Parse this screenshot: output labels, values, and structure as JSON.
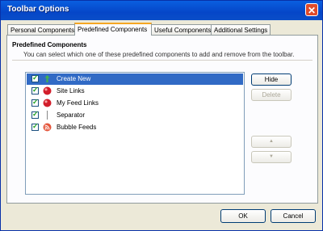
{
  "window": {
    "title": "Toolbar Options",
    "close_glyph": "✕"
  },
  "tabs": [
    {
      "label": "Personal Components"
    },
    {
      "label": "Predefined Components"
    },
    {
      "label": "Useful Components"
    },
    {
      "label": "Additional Settings"
    }
  ],
  "active_tab": "Predefined Components",
  "section": {
    "title": "Predefined Components",
    "description": "You can select which one of these predefined components to add and remove from the toolbar."
  },
  "components": [
    {
      "label": "Create New",
      "checked": true,
      "icon": "green-arrow-icon",
      "selected": true
    },
    {
      "label": "Site Links",
      "checked": true,
      "icon": "red-ball-icon",
      "selected": false
    },
    {
      "label": "My Feed Links",
      "checked": true,
      "icon": "red-ball-icon",
      "selected": false
    },
    {
      "label": "Separator",
      "checked": true,
      "icon": "separator-icon",
      "selected": false
    },
    {
      "label": "Bubble Feeds",
      "checked": true,
      "icon": "rss-bubble-icon",
      "selected": false
    }
  ],
  "side_buttons": {
    "hide": "Hide",
    "delete": "Delete",
    "up": "▲",
    "down": "▼"
  },
  "footer": {
    "ok": "OK",
    "cancel": "Cancel"
  },
  "colors": {
    "title_bar": "#0546c8",
    "selection": "#316ac5",
    "tab_highlight": "#f5a623"
  }
}
